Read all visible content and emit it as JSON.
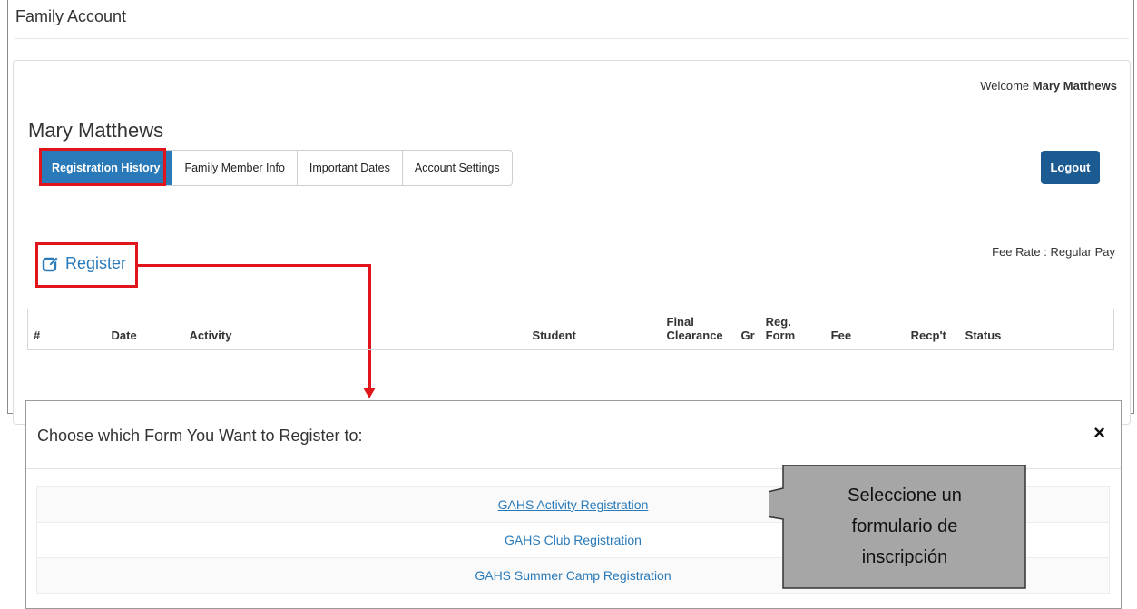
{
  "page": {
    "header": "Family Account"
  },
  "welcome": {
    "prefix": "Welcome",
    "name": "Mary Matthews"
  },
  "user_name": "Mary Matthews",
  "tabs": [
    {
      "label": "Registration History",
      "active": true
    },
    {
      "label": "Family Member Info",
      "active": false
    },
    {
      "label": "Important Dates",
      "active": false
    },
    {
      "label": "Account Settings",
      "active": false
    }
  ],
  "logout_label": "Logout",
  "fee_rate": "Fee Rate : Regular Pay",
  "register": {
    "label": "Register",
    "icon": "edit-icon"
  },
  "table": {
    "headers": [
      "#",
      "Date",
      "Activity",
      "Student",
      "Final Clearance",
      "Gr",
      "Reg. Form",
      "Fee",
      "Recp't",
      "Status"
    ]
  },
  "modal": {
    "title": "Choose which Form You Want to Register to:",
    "close": "×",
    "forms": [
      "GAHS Activity Registration",
      "GAHS Club Registration",
      "GAHS Summer Camp Registration"
    ]
  },
  "callout": {
    "text_lines": [
      "Seleccione un",
      "formulario de",
      "inscripción"
    ]
  },
  "colors": {
    "accent": "#2a7ab9",
    "logout": "#1b5b92",
    "highlight": "#e0141b",
    "callout_fill": "#a6a6a6"
  }
}
